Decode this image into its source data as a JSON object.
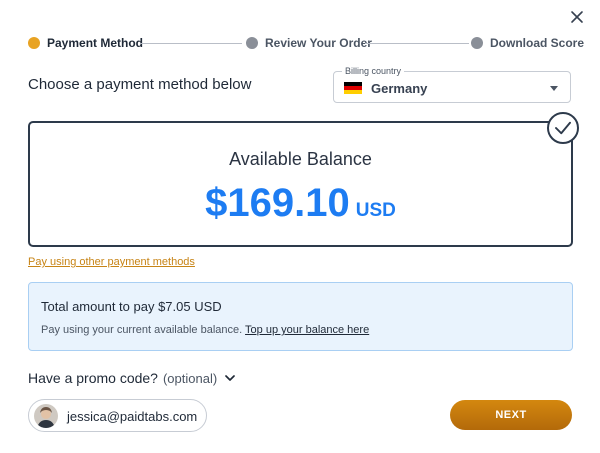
{
  "colors": {
    "accent": "#e8a323",
    "inactive": "#8a8f98",
    "balance": "#1d7cf2",
    "link": "#c78416",
    "info_bg": "#e9f3fd",
    "button": "#c47b0e"
  },
  "steps": [
    {
      "label": "Payment Method",
      "state": "active"
    },
    {
      "label": "Review Your Order",
      "state": "pending"
    },
    {
      "label": "Download Score",
      "state": "pending"
    }
  ],
  "close_icon": "close-icon",
  "payment": {
    "heading": "Choose a payment method below",
    "billing_country_label": "Billing country",
    "billing_country_value": "Germany",
    "flag_icon": "germany-flag-icon"
  },
  "balance": {
    "title": "Available Balance",
    "amount": "$169.10",
    "currency": "USD",
    "selected": true
  },
  "other_methods_link": "Pay using other payment methods",
  "total": {
    "line": "Total amount to pay $7.05 USD",
    "sub_text": "Pay using your current available balance.",
    "topup_link": "Top up your balance here"
  },
  "promo": {
    "label": "Have a promo code?",
    "optional": "(optional)"
  },
  "user": {
    "email": "jessica@paidtabs.com"
  },
  "next_button": "NEXT"
}
